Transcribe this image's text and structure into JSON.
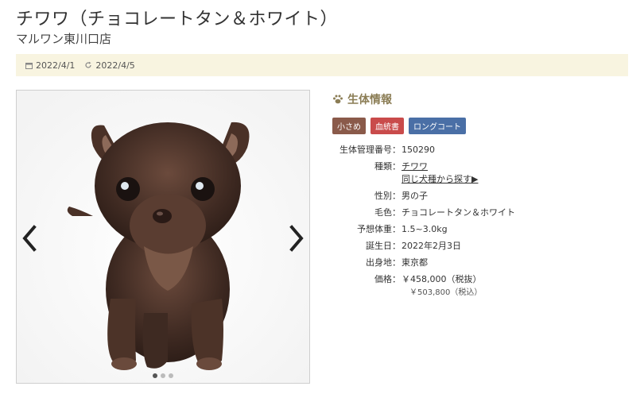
{
  "page": {
    "title": "チワワ（チョコレートタン＆ホワイト）",
    "subtitle": "マルワン東川口店",
    "published_date": "2022/4/1",
    "updated_date": "2022/4/5"
  },
  "gallery": {
    "slide_count": 3,
    "active_index": 0
  },
  "info": {
    "heading": "生体情報",
    "badges": [
      "小さめ",
      "血統書",
      "ロングコート"
    ],
    "badge_colors": [
      "#8a5a4a",
      "#c94b4b",
      "#4a6fa6"
    ],
    "rows": {
      "id_label": "生体管理番号：",
      "id_value": "150290",
      "breed_label": "種類：",
      "breed_value": "チワワ",
      "breed_link": "同じ犬種から探す▶",
      "sex_label": "性別：",
      "sex_value": "男の子",
      "color_label": "毛色：",
      "color_value": "チョコレートタン＆ホワイト",
      "weight_label": "予想体重：",
      "weight_value": "1.5~3.0kg",
      "birthday_label": "誕生日：",
      "birthday_value": "2022年2月3日",
      "origin_label": "出身地：",
      "origin_value": "東京都",
      "price_label": "価格：",
      "price_value": "￥458,000（税抜）",
      "price_tax": "￥503,800（税込）"
    }
  },
  "colors": {
    "accent": "#8b7d55",
    "date_bar_bg": "#f8f4e0"
  }
}
